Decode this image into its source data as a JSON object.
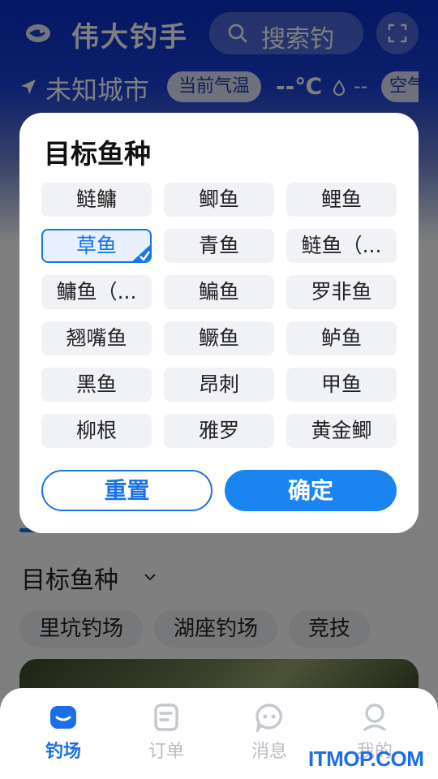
{
  "header": {
    "app_title": "伟大钓手",
    "search_placeholder": "搜索钓",
    "location": "未知城市",
    "weather_badge": "当前气温",
    "temperature": "--℃",
    "humidity": "--",
    "air_badge": "空气"
  },
  "section": {
    "title": "目标鱼种",
    "chips": [
      "里坑钓场",
      "湖座钓场",
      "竞技"
    ]
  },
  "dialog": {
    "title": "目标鱼种",
    "options": [
      {
        "label": "鲢鳙",
        "selected": false
      },
      {
        "label": "鲫鱼",
        "selected": false
      },
      {
        "label": "鲤鱼",
        "selected": false
      },
      {
        "label": "草鱼",
        "selected": true
      },
      {
        "label": "青鱼",
        "selected": false
      },
      {
        "label": "鲢鱼（...",
        "selected": false
      },
      {
        "label": "鳙鱼（...",
        "selected": false
      },
      {
        "label": "鳊鱼",
        "selected": false
      },
      {
        "label": "罗非鱼",
        "selected": false
      },
      {
        "label": "翘嘴鱼",
        "selected": false
      },
      {
        "label": "鳜鱼",
        "selected": false
      },
      {
        "label": "鲈鱼",
        "selected": false
      },
      {
        "label": "黑鱼",
        "selected": false
      },
      {
        "label": "昂刺",
        "selected": false
      },
      {
        "label": "甲鱼",
        "selected": false
      },
      {
        "label": "柳根",
        "selected": false
      },
      {
        "label": "雅罗",
        "selected": false
      },
      {
        "label": "黄金鲫",
        "selected": false
      }
    ],
    "reset_label": "重置",
    "confirm_label": "确定"
  },
  "bottom_nav": [
    {
      "label": "钓场",
      "icon": "fishing-spot-icon",
      "active": true
    },
    {
      "label": "订单",
      "icon": "order-icon",
      "active": false
    },
    {
      "label": "消息",
      "icon": "message-icon",
      "active": false
    },
    {
      "label": "我的",
      "icon": "profile-icon",
      "active": false
    }
  ],
  "watermark": "ITMOP.COM",
  "colors": {
    "primary": "#1a73e8",
    "header_blue": "#0a2fc8",
    "overlay": "rgba(0,0,0,0.5)"
  }
}
